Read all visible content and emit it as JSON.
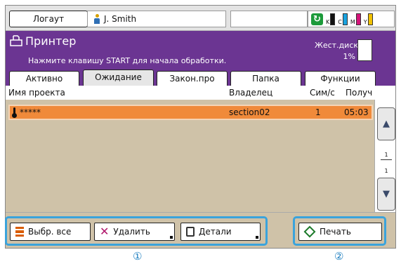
{
  "topbar": {
    "logout_label": "Логаут",
    "user_name": "J. Smith",
    "toner": [
      {
        "label": "K",
        "color": "#111111"
      },
      {
        "label": "C",
        "color": "#1aa3e0"
      },
      {
        "label": "M",
        "color": "#d4157a"
      },
      {
        "label": "Y",
        "color": "#f2c200"
      }
    ]
  },
  "header": {
    "title": "Принтер",
    "subtitle": "Нажмите клавишу START для начала обработки.",
    "disk_label": "Жест.диск",
    "disk_percent": "1%"
  },
  "tabs": [
    {
      "label": "Активно",
      "active": false
    },
    {
      "label": "Ожидание",
      "active": true
    },
    {
      "label": "Закон.про",
      "active": false
    },
    {
      "label": "Папка",
      "active": false
    },
    {
      "label": "Функции",
      "active": false
    }
  ],
  "table": {
    "columns": [
      "Имя проекта",
      "Владелец",
      "Сим/с",
      "Получ"
    ],
    "rows": [
      {
        "name": "*****",
        "owner": "section02",
        "copies": "1",
        "received": "05:03"
      }
    ]
  },
  "pager": {
    "current": "1",
    "total": "1"
  },
  "actions": {
    "select_all": "Выбр. все",
    "delete": "Удалить",
    "details": "Детали",
    "print": "Печать"
  },
  "callouts": [
    "①",
    "②"
  ],
  "colors": {
    "accent": "#6b3592",
    "selected_row": "#f08a3a",
    "highlight": "#3aa3dc"
  }
}
